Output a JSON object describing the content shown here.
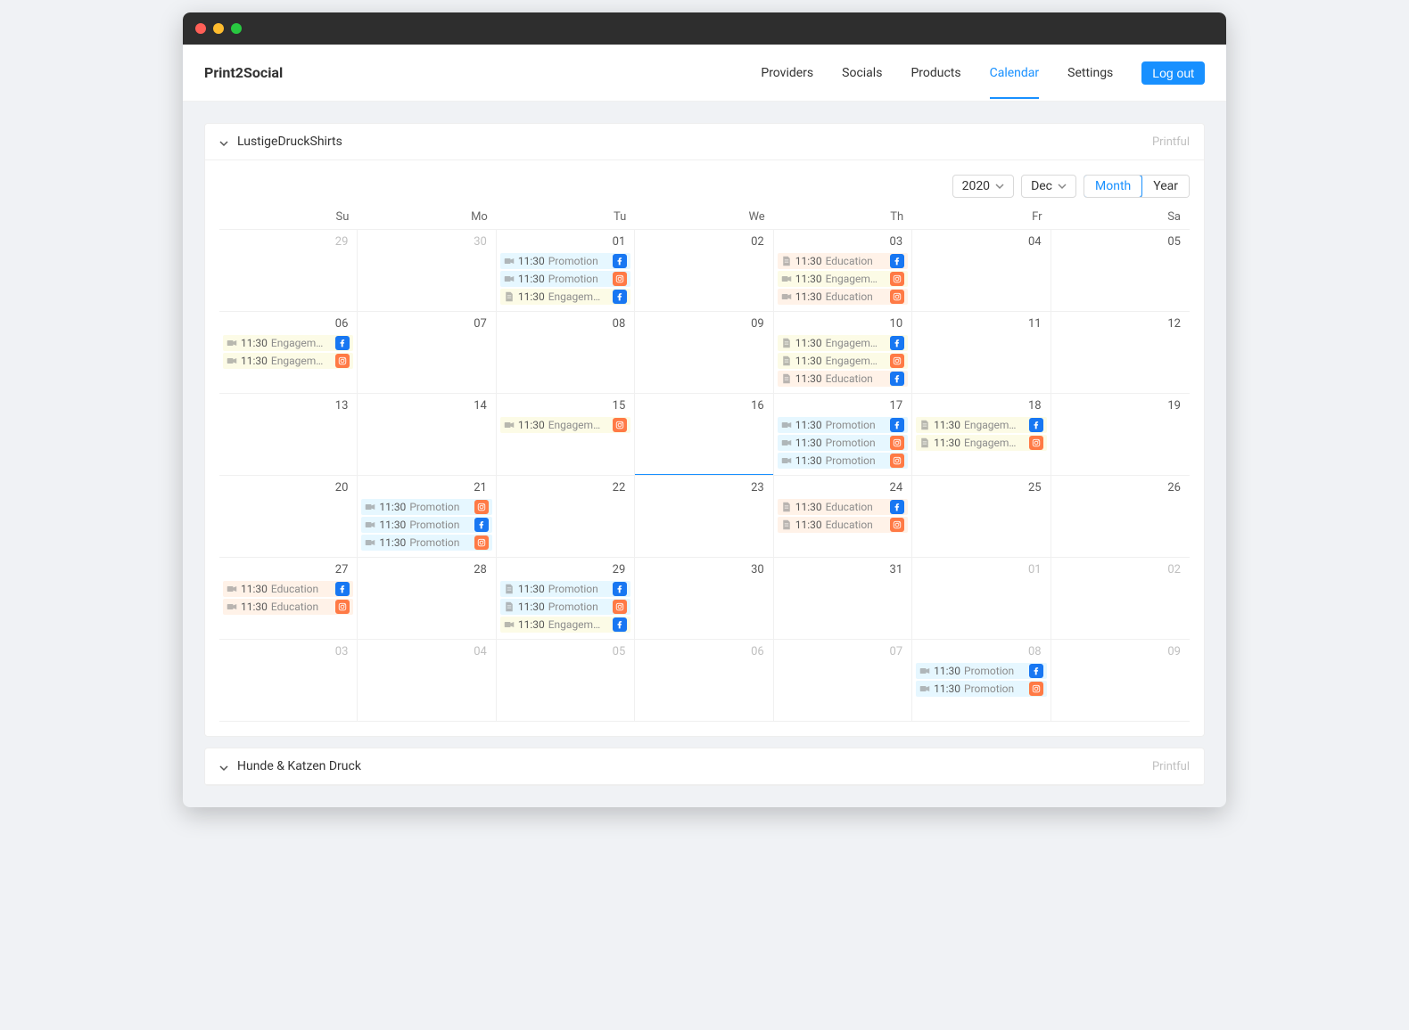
{
  "brand": "Print2Social",
  "nav": {
    "providers": "Providers",
    "socials": "Socials",
    "products": "Products",
    "calendar": "Calendar",
    "settings": "Settings",
    "logout": "Log out"
  },
  "panels": [
    {
      "title": "LustigeDruckShirts",
      "provider": "Printful",
      "expanded": true
    },
    {
      "title": "Hunde & Katzen Druck",
      "provider": "Printful",
      "expanded": false
    }
  ],
  "controls": {
    "year": "2020",
    "month": "Dec",
    "view_month": "Month",
    "view_year": "Year"
  },
  "dows": [
    "Su",
    "Mo",
    "Tu",
    "We",
    "Th",
    "Fr",
    "Sa"
  ],
  "categories": {
    "promotion": "Promotion",
    "promotion_time": "11:30",
    "engagement": "Engagem…",
    "engagement_time": "11:30",
    "education": "Education",
    "education_time": "11:30"
  },
  "socials": {
    "facebook": "facebook",
    "instagram": "instagram"
  },
  "days": [
    {
      "n": "29",
      "dim": true,
      "events": []
    },
    {
      "n": "30",
      "dim": true,
      "events": []
    },
    {
      "n": "01",
      "events": [
        {
          "cat": "promotion",
          "icon": "video",
          "social": "fb"
        },
        {
          "cat": "promotion",
          "icon": "video",
          "social": "ig"
        },
        {
          "cat": "engagement",
          "icon": "doc",
          "social": "fb"
        }
      ]
    },
    {
      "n": "02",
      "events": []
    },
    {
      "n": "03",
      "events": [
        {
          "cat": "education",
          "icon": "doc",
          "social": "fb"
        },
        {
          "cat": "engagement",
          "icon": "video",
          "social": "ig"
        },
        {
          "cat": "education",
          "icon": "video",
          "social": "ig"
        }
      ]
    },
    {
      "n": "04",
      "events": []
    },
    {
      "n": "05",
      "events": []
    },
    {
      "n": "06",
      "events": [
        {
          "cat": "engagement",
          "icon": "video",
          "social": "fb"
        },
        {
          "cat": "engagement",
          "icon": "video",
          "social": "ig"
        }
      ]
    },
    {
      "n": "07",
      "events": []
    },
    {
      "n": "08",
      "events": []
    },
    {
      "n": "09",
      "events": []
    },
    {
      "n": "10",
      "events": [
        {
          "cat": "engagement",
          "icon": "doc",
          "social": "fb"
        },
        {
          "cat": "engagement",
          "icon": "doc",
          "social": "ig"
        },
        {
          "cat": "education",
          "icon": "doc",
          "social": "fb"
        }
      ]
    },
    {
      "n": "11",
      "events": []
    },
    {
      "n": "12",
      "events": []
    },
    {
      "n": "13",
      "events": []
    },
    {
      "n": "14",
      "events": []
    },
    {
      "n": "15",
      "events": [
        {
          "cat": "engagement",
          "icon": "video",
          "social": "ig"
        }
      ]
    },
    {
      "n": "16",
      "today": true,
      "events": []
    },
    {
      "n": "17",
      "events": [
        {
          "cat": "promotion",
          "icon": "video",
          "social": "fb"
        },
        {
          "cat": "promotion",
          "icon": "video",
          "social": "ig"
        },
        {
          "cat": "promotion",
          "icon": "video",
          "social": "ig"
        }
      ]
    },
    {
      "n": "18",
      "events": [
        {
          "cat": "engagement",
          "icon": "doc",
          "social": "fb"
        },
        {
          "cat": "engagement",
          "icon": "doc",
          "social": "ig"
        }
      ]
    },
    {
      "n": "19",
      "events": []
    },
    {
      "n": "20",
      "events": []
    },
    {
      "n": "21",
      "events": [
        {
          "cat": "promotion",
          "icon": "video",
          "social": "ig"
        },
        {
          "cat": "promotion",
          "icon": "video",
          "social": "fb"
        },
        {
          "cat": "promotion",
          "icon": "video",
          "social": "ig"
        }
      ]
    },
    {
      "n": "22",
      "events": []
    },
    {
      "n": "23",
      "events": []
    },
    {
      "n": "24",
      "events": [
        {
          "cat": "education",
          "icon": "doc",
          "social": "fb"
        },
        {
          "cat": "education",
          "icon": "doc",
          "social": "ig"
        }
      ]
    },
    {
      "n": "25",
      "events": []
    },
    {
      "n": "26",
      "events": []
    },
    {
      "n": "27",
      "events": [
        {
          "cat": "education",
          "icon": "video",
          "social": "fb"
        },
        {
          "cat": "education",
          "icon": "video",
          "social": "ig"
        }
      ]
    },
    {
      "n": "28",
      "events": []
    },
    {
      "n": "29",
      "events": [
        {
          "cat": "promotion",
          "icon": "doc",
          "social": "fb"
        },
        {
          "cat": "promotion",
          "icon": "doc",
          "social": "ig"
        },
        {
          "cat": "engagement",
          "icon": "video",
          "social": "fb"
        }
      ]
    },
    {
      "n": "30",
      "events": []
    },
    {
      "n": "31",
      "events": []
    },
    {
      "n": "01",
      "dim": true,
      "events": []
    },
    {
      "n": "02",
      "dim": true,
      "events": []
    },
    {
      "n": "03",
      "dim": true,
      "events": []
    },
    {
      "n": "04",
      "dim": true,
      "events": []
    },
    {
      "n": "05",
      "dim": true,
      "events": []
    },
    {
      "n": "06",
      "dim": true,
      "events": []
    },
    {
      "n": "07",
      "dim": true,
      "events": []
    },
    {
      "n": "08",
      "dim": true,
      "events": [
        {
          "cat": "promotion",
          "icon": "video",
          "social": "fb"
        },
        {
          "cat": "promotion",
          "icon": "video",
          "social": "ig"
        }
      ]
    },
    {
      "n": "09",
      "dim": true,
      "events": []
    }
  ]
}
